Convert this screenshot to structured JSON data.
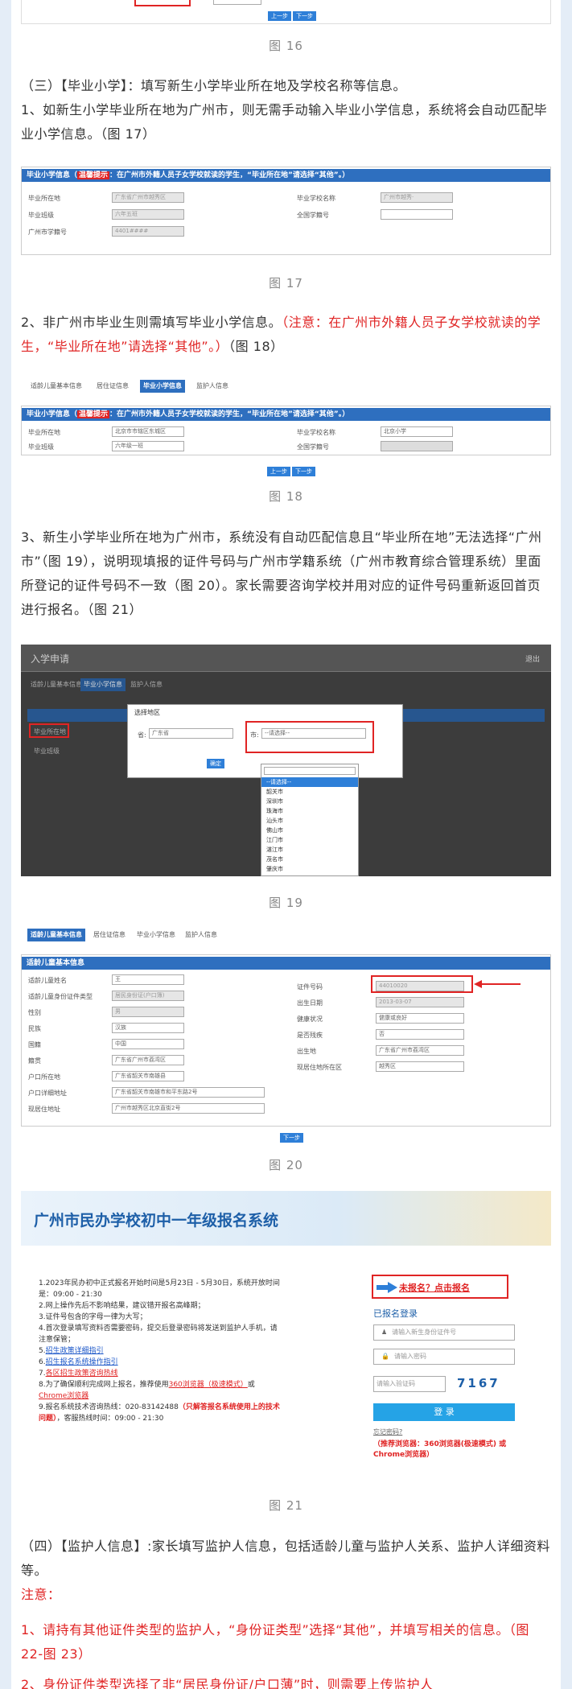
{
  "top": {
    "prev": "上一步",
    "next": "下一步",
    "fig16": "图 16"
  },
  "sec3": {
    "heading": "（三）【毕业小学】：填写新生小学毕业所在地及学校名称等信息。",
    "p1": "1、如新生小学毕业所在地为广州市，则无需手动输入毕业小学信息，系统将会自动匹配毕业小学信息。（图 17）"
  },
  "fig17": {
    "bar": "毕业小学信息（",
    "bar_hl": "温馨提示",
    "bar_rest": "：在广州市外籍人员子女学校就读的学生，“毕业所在地”请选择“其他”。）",
    "labels": [
      "毕业所在地",
      "毕业班级",
      "广州市学籍号"
    ],
    "labels2": [
      "毕业学校名称",
      "全国学籍号"
    ],
    "values": [
      "广东省广州市越秀区",
      "六年五班",
      "4401####"
    ],
    "value_school": "广州市越秀·",
    "caption": "图 17"
  },
  "p2": {
    "text": "2、非广州市毕业生则需填写毕业小学信息。",
    "red": "（注意：在广州市外籍人员子女学校就读的学生，“毕业所在地”请选择“其他”。）",
    "tail": "（图 18）"
  },
  "fig18": {
    "tabs": [
      "适龄儿童基本信息",
      "居住证信息",
      "毕业小学信息",
      "监护人信息"
    ],
    "labels": [
      "毕业所在地",
      "毕业班级"
    ],
    "labels2": [
      "毕业学校名称",
      "全国学籍号"
    ],
    "values": [
      "北京市市辖区东城区",
      "六年级一班"
    ],
    "school": "北京小学",
    "caption": "图 18"
  },
  "p3": {
    "text": "3、新生小学毕业所在地为广州市，系统没有自动匹配信息且“毕业所在地”无法选择“广州市”（图 19），说明现填报的证件号码与广州市学籍系统（广州市教育综合管理系统）里面所登记的证件号码不一致（图 20）。家长需要咨询学校并用对应的证件号码重新返回首页进行报名。（图 21）"
  },
  "fig19": {
    "title": "入学申请",
    "exit": "退出",
    "tabs": [
      "适龄儿童基本信息",
      "毕业小学信息",
      "监护人信息"
    ],
    "dialog_title": "选择地区",
    "province_label": "省:",
    "province": "广东省",
    "city_label": "市:",
    "city": "--请选择--",
    "ok": "确定",
    "options": [
      "--请选择--",
      "韶关市",
      "深圳市",
      "珠海市",
      "汕头市",
      "佛山市",
      "江门市",
      "湛江市",
      "茂名市",
      "肇庆市"
    ],
    "left_label": "毕业所在地",
    "left_label2": "毕业班级",
    "caption": "图 19"
  },
  "fig20": {
    "tabs": [
      "适龄儿童基本信息",
      "居住证信息",
      "毕业小学信息",
      "监护人信息"
    ],
    "bar": "适龄儿童基本信息",
    "left_labels": [
      "适龄儿童姓名",
      "适龄儿童身份证件类型",
      "性别",
      "民族",
      "国籍",
      "籍贯",
      "户口所在地",
      "户口详细地址",
      "现居住地址"
    ],
    "left_values": [
      "王",
      "居民身份证(户口簿)",
      "男",
      "汉族",
      "中国",
      "广东省广州市荔湾区",
      "广东省韶关市南雄县",
      "广东省韶关市南雄市和平东路2号",
      "广州市越秀区北京直街2号"
    ],
    "right_labels": [
      "证件号码",
      "出生日期",
      "健康状况",
      "是否残疾",
      "出生地",
      "现居住地所在区"
    ],
    "right_values": [
      "44010020",
      "2013-03-07",
      "健康或良好",
      "否",
      "广东省广州市荔湾区",
      "越秀区"
    ],
    "next": "下一步",
    "caption": "图 20"
  },
  "fig21": {
    "title": "广州市民办学校初中一年级报名系统",
    "notes": [
      "1.2023年民办初中正式报名开始时间是5月23日 - 5月30日，系统开放时间是：09:00 - 21:30",
      "2.网上操作先后不影响结果，建议错开报名高峰期；",
      "3.证件号包含的字母一律为大写；",
      "4.首次登录填写资料否需要密码，提交后登录密码将发送到监护人手机，请注意保管；"
    ],
    "link5": "招生政策详细指引",
    "link6": "招生报名系统操作指引",
    "link7": "各区招生政策咨询热线",
    "note8_a": "8.为了确保顺利完成网上报名，推荐使用",
    "note8_link": "360浏览器（极速模式）",
    "note8_b": "或",
    "note8_link2": "Chrome浏览器",
    "note9_a": "9.报名系统技术咨询热线：020-83142488",
    "note9_red": "（只解答报名系统使用上的技术问题）",
    "note9_b": "，客服热线时间：09:00 - 21:30",
    "not_registered": "未报名？点击报名",
    "registered_login": "已报名登录",
    "id_placeholder": "请输入新生身份证件号",
    "pwd_placeholder": "请输入密码",
    "captcha_placeholder": "请输入验证码",
    "captcha": "7167",
    "login": "登 录",
    "forgot": "忘记密码?",
    "browser_note": "（推荐浏览器：360浏览器(极速模式) 或 Chrome浏览器）",
    "caption": "图 21"
  },
  "sec4": {
    "heading": "（四）【监护人信息】:家长填写监护人信息，包括适龄儿童与监护人关系、监护人详细资料等。",
    "note": "注意：",
    "n1": "1、请持有其他证件类型的监护人，“身份证类型”选择“其他”，并填写相关的信息。（图 22-图 23）",
    "n2": "2、身份证件类型选择了非“居民身份证/户口薄”时，则需要上传监护人"
  },
  "colors": {
    "blue": "#2e6fbf",
    "red": "#e02424",
    "bg": "#e4edf7"
  }
}
